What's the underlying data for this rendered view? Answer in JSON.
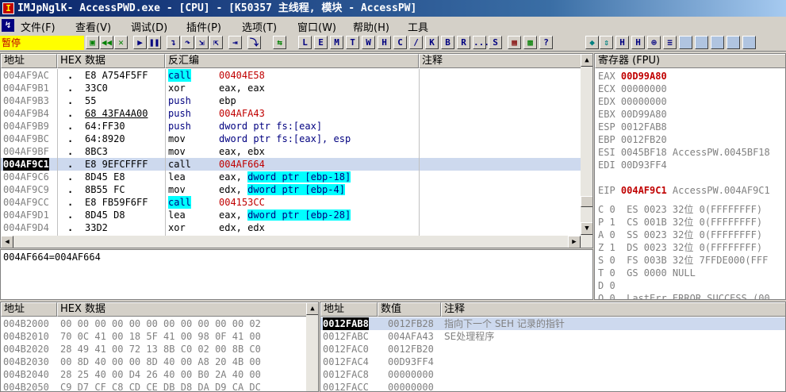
{
  "window": {
    "title": "IMJpNglK- AccessPWD.exe - [CPU] - [K50357 主线程, 模块 - AccessPW]"
  },
  "menu": [
    "文件(F)",
    "查看(V)",
    "调试(D)",
    "插件(P)",
    "选项(T)",
    "窗口(W)",
    "帮助(H)",
    "工具"
  ],
  "status": "暂停",
  "toolbar_letters": [
    "L",
    "E",
    "M",
    "T",
    "W",
    "H",
    "C",
    "/",
    "K",
    "B",
    "R",
    "...",
    "S"
  ],
  "disasm": {
    "headers": {
      "addr": "地址",
      "hex": "HEX 数据",
      "asm": "反汇编",
      "comment": "注释"
    },
    "rows": [
      {
        "addr": "004AF9AC",
        "mark": ".",
        "hex": "E8 A754F5FF",
        "mn": "call",
        "op": "00404E58",
        "mncyan": true,
        "opred": true
      },
      {
        "addr": "004AF9B1",
        "mark": ".",
        "hex": "33C0",
        "mn": "xor",
        "op": "eax, eax"
      },
      {
        "addr": "004AF9B3",
        "mark": ".",
        "hex": "55",
        "mn": "push",
        "op": "ebp",
        "mnblue": true
      },
      {
        "addr": "004AF9B4",
        "mark": ".",
        "hex": "68 43FA4A00",
        "mn": "push",
        "op": "004AFA43",
        "mnblue": true,
        "opred": true,
        "hexul": true
      },
      {
        "addr": "004AF9B9",
        "mark": ".",
        "hex": "64:FF30",
        "mn": "push",
        "op": "dword ptr fs:[eax]",
        "mnblue": true,
        "opblue": true
      },
      {
        "addr": "004AF9BC",
        "mark": ".",
        "hex": "64:8920",
        "mn": "mov",
        "op": "dword ptr fs:[eax], esp",
        "opblue": true
      },
      {
        "addr": "004AF9BF",
        "mark": ".",
        "hex": "8BC3",
        "mn": "mov",
        "op": "eax, ebx"
      },
      {
        "addr": "004AF9C1",
        "mark": ".",
        "hex": "E8 9EFCFFFF",
        "mn": "call",
        "op": "004AF664",
        "sel": true,
        "opred": true
      },
      {
        "addr": "004AF9C6",
        "mark": ".",
        "hex": "8D45 E8",
        "mn": "lea",
        "op": "eax, ",
        "op2": "dword ptr [ebp-18]"
      },
      {
        "addr": "004AF9C9",
        "mark": ".",
        "hex": "8B55 FC",
        "mn": "mov",
        "op": "edx, ",
        "op2": "dword ptr [ebp-4]"
      },
      {
        "addr": "004AF9CC",
        "mark": ".",
        "hex": "E8 FB59F6FF",
        "mn": "call",
        "op": "004153CC",
        "mncyan": true,
        "opred": true
      },
      {
        "addr": "004AF9D1",
        "mark": ".",
        "hex": "8D45 D8",
        "mn": "lea",
        "op": "eax, ",
        "op2": "dword ptr [ebp-28]"
      },
      {
        "addr": "004AF9D4",
        "mark": ".",
        "hex": "33D2",
        "mn": "xor",
        "op": "edx, edx"
      }
    ]
  },
  "info_line": "004AF664=004AF664",
  "registers": {
    "header": "寄存器 (FPU)",
    "gp": [
      {
        "n": "EAX",
        "v": "00D99A80",
        "red": true,
        "x": ""
      },
      {
        "n": "ECX",
        "v": "00000000",
        "x": ""
      },
      {
        "n": "EDX",
        "v": "00000000",
        "x": ""
      },
      {
        "n": "EBX",
        "v": "00D99A80",
        "x": ""
      },
      {
        "n": "ESP",
        "v": "0012FAB8",
        "x": ""
      },
      {
        "n": "EBP",
        "v": "0012FB20",
        "x": ""
      },
      {
        "n": "ESI",
        "v": "0045BF18",
        "x": "AccessPW.0045BF18"
      },
      {
        "n": "EDI",
        "v": "00D93FF4",
        "x": ""
      }
    ],
    "eip": {
      "n": "EIP",
      "v": "004AF9C1",
      "x": "AccessPW.004AF9C1"
    },
    "flags": [
      "C 0  ES 0023 32位 0(FFFFFFFF)",
      "P 1  CS 001B 32位 0(FFFFFFFF)",
      "A 0  SS 0023 32位 0(FFFFFFFF)",
      "Z 1  DS 0023 32位 0(FFFFFFFF)",
      "S 0  FS 003B 32位 7FFDE000(FFF",
      "T 0  GS 0000 NULL",
      "D 0",
      "O 0  LastErr ERROR_SUCCESS (00"
    ]
  },
  "dump": {
    "headers": {
      "addr": "地址",
      "hex": "HEX 数据"
    },
    "rows": [
      {
        "addr": "004B2000",
        "hex": "00 00 00 00 00 00 00 00 00 00 00 02"
      },
      {
        "addr": "004B2010",
        "hex": "70 0C 41 00 18 5F 41 00 98 0F 41 00"
      },
      {
        "addr": "004B2020",
        "hex": "28 49 41 00 72 13 8B C0 02 00 8B C0"
      },
      {
        "addr": "004B2030",
        "hex": "00 8D 40 00 00 8D 40 00 A8 20 4B 00"
      },
      {
        "addr": "004B2040",
        "hex": "28 25 40 00 D4 26 40 00 B0 2A 40 00"
      },
      {
        "addr": "004B2050",
        "hex": "C9 D7 CF C8 CD CE DB D8 DA D9 CA DC"
      }
    ]
  },
  "stack": {
    "headers": {
      "addr": "地址",
      "val": "数值",
      "comment": "注释"
    },
    "rows": [
      {
        "addr": "0012FAB8",
        "val": "0012FB28",
        "c": "指向下一个 SEH 记录的指针",
        "sel": true
      },
      {
        "addr": "0012FABC",
        "val": "004AFA43",
        "c": "SE处理程序"
      },
      {
        "addr": "0012FAC0",
        "val": "0012FB20",
        "c": ""
      },
      {
        "addr": "0012FAC4",
        "val": "00D93FF4",
        "c": ""
      },
      {
        "addr": "0012FAC8",
        "val": "00000000",
        "c": ""
      },
      {
        "addr": "0012FACC",
        "val": "00000000",
        "c": ""
      }
    ]
  }
}
